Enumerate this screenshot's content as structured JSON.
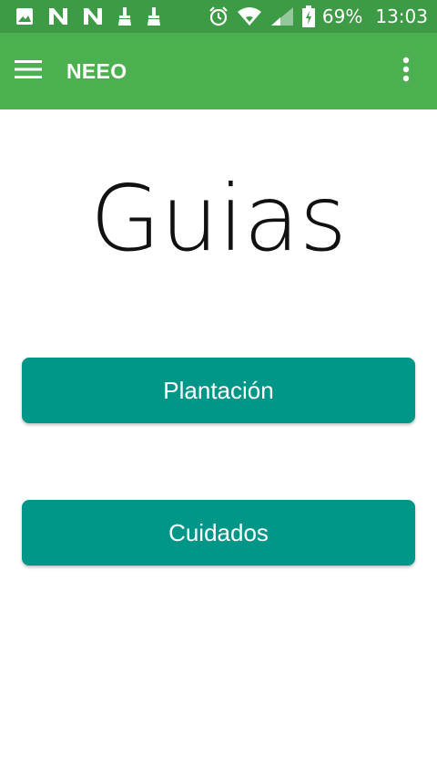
{
  "status_bar": {
    "icons_left": [
      "image-icon",
      "n-notification-icon",
      "n-notification-icon",
      "cleaner-icon",
      "cleaner-icon"
    ],
    "icons_right": [
      "alarm-icon",
      "wifi-icon",
      "signal-icon",
      "battery-charging-icon"
    ],
    "battery": "69%",
    "time": "13:03"
  },
  "app_bar": {
    "title": "NEEO",
    "menu_icon": "hamburger-menu-icon",
    "overflow_icon": "more-vert-icon"
  },
  "main": {
    "title": "Guias",
    "buttons": [
      {
        "label": "Plantación"
      },
      {
        "label": "Cuidados"
      }
    ]
  },
  "colors": {
    "status_bar": "#3d9a45",
    "app_bar": "#4caf50",
    "button": "#009688",
    "button_text": "#ffffff",
    "title_text": "#111111"
  }
}
